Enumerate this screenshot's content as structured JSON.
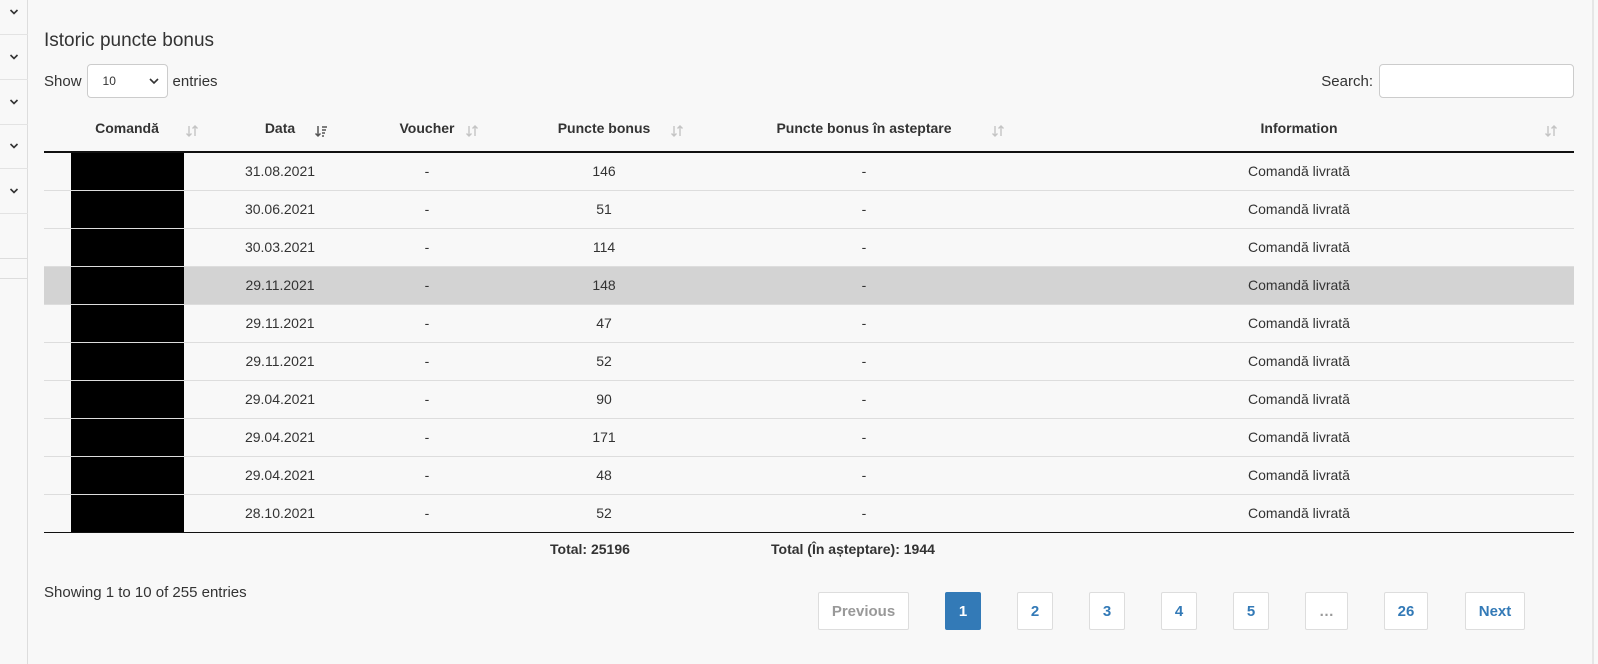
{
  "colors": {
    "accent": "#337ab7",
    "highlight_row": "#d3d3d3",
    "redaction": "#000000"
  },
  "sidebar": {
    "items": [
      {
        "icon": "chevron-down-icon"
      },
      {
        "icon": "chevron-down-icon"
      },
      {
        "icon": "chevron-down-icon"
      },
      {
        "icon": "chevron-down-icon"
      },
      {
        "icon": "chevron-down-icon"
      }
    ]
  },
  "page": {
    "title": "Istoric puncte bonus"
  },
  "length_menu": {
    "show_label": "Show",
    "selected": "10",
    "entries_label": "entries"
  },
  "search": {
    "label": "Search:",
    "value": ""
  },
  "table": {
    "columns": [
      "Comandă",
      "Data",
      "Voucher",
      "Puncte bonus",
      "Puncte bonus în asteptare",
      "Information"
    ],
    "sorted_column": "Data",
    "rows": [
      {
        "comanda": "",
        "data": "31.08.2021",
        "voucher": "-",
        "puncte": "146",
        "asteptare": "-",
        "information": "Comandă livrată"
      },
      {
        "comanda": "",
        "data": "30.06.2021",
        "voucher": "-",
        "puncte": "51",
        "asteptare": "-",
        "information": "Comandă livrată"
      },
      {
        "comanda": "",
        "data": "30.03.2021",
        "voucher": "-",
        "puncte": "114",
        "asteptare": "-",
        "information": "Comandă livrată"
      },
      {
        "comanda": "",
        "data": "29.11.2021",
        "voucher": "-",
        "puncte": "148",
        "asteptare": "-",
        "information": "Comandă livrată",
        "highlighted": true
      },
      {
        "comanda": "",
        "data": "29.11.2021",
        "voucher": "-",
        "puncte": "47",
        "asteptare": "-",
        "information": "Comandă livrată"
      },
      {
        "comanda": "",
        "data": "29.11.2021",
        "voucher": "-",
        "puncte": "52",
        "asteptare": "-",
        "information": "Comandă livrată"
      },
      {
        "comanda": "",
        "data": "29.04.2021",
        "voucher": "-",
        "puncte": "90",
        "asteptare": "-",
        "information": "Comandă livrată"
      },
      {
        "comanda": "",
        "data": "29.04.2021",
        "voucher": "-",
        "puncte": "171",
        "asteptare": "-",
        "information": "Comandă livrată"
      },
      {
        "comanda": "",
        "data": "29.04.2021",
        "voucher": "-",
        "puncte": "48",
        "asteptare": "-",
        "information": "Comandă livrată"
      },
      {
        "comanda": "",
        "data": "28.10.2021",
        "voucher": "-",
        "puncte": "52",
        "asteptare": "-",
        "information": "Comandă livrată"
      }
    ],
    "footer": {
      "total": "Total: 25196",
      "total_pending": "Total (În așteptare): 1944"
    }
  },
  "info": "Showing 1 to 10 of 255 entries",
  "pagination": {
    "previous": "Previous",
    "pages": [
      "1",
      "2",
      "3",
      "4",
      "5",
      "…",
      "26"
    ],
    "current": "1",
    "next": "Next"
  }
}
